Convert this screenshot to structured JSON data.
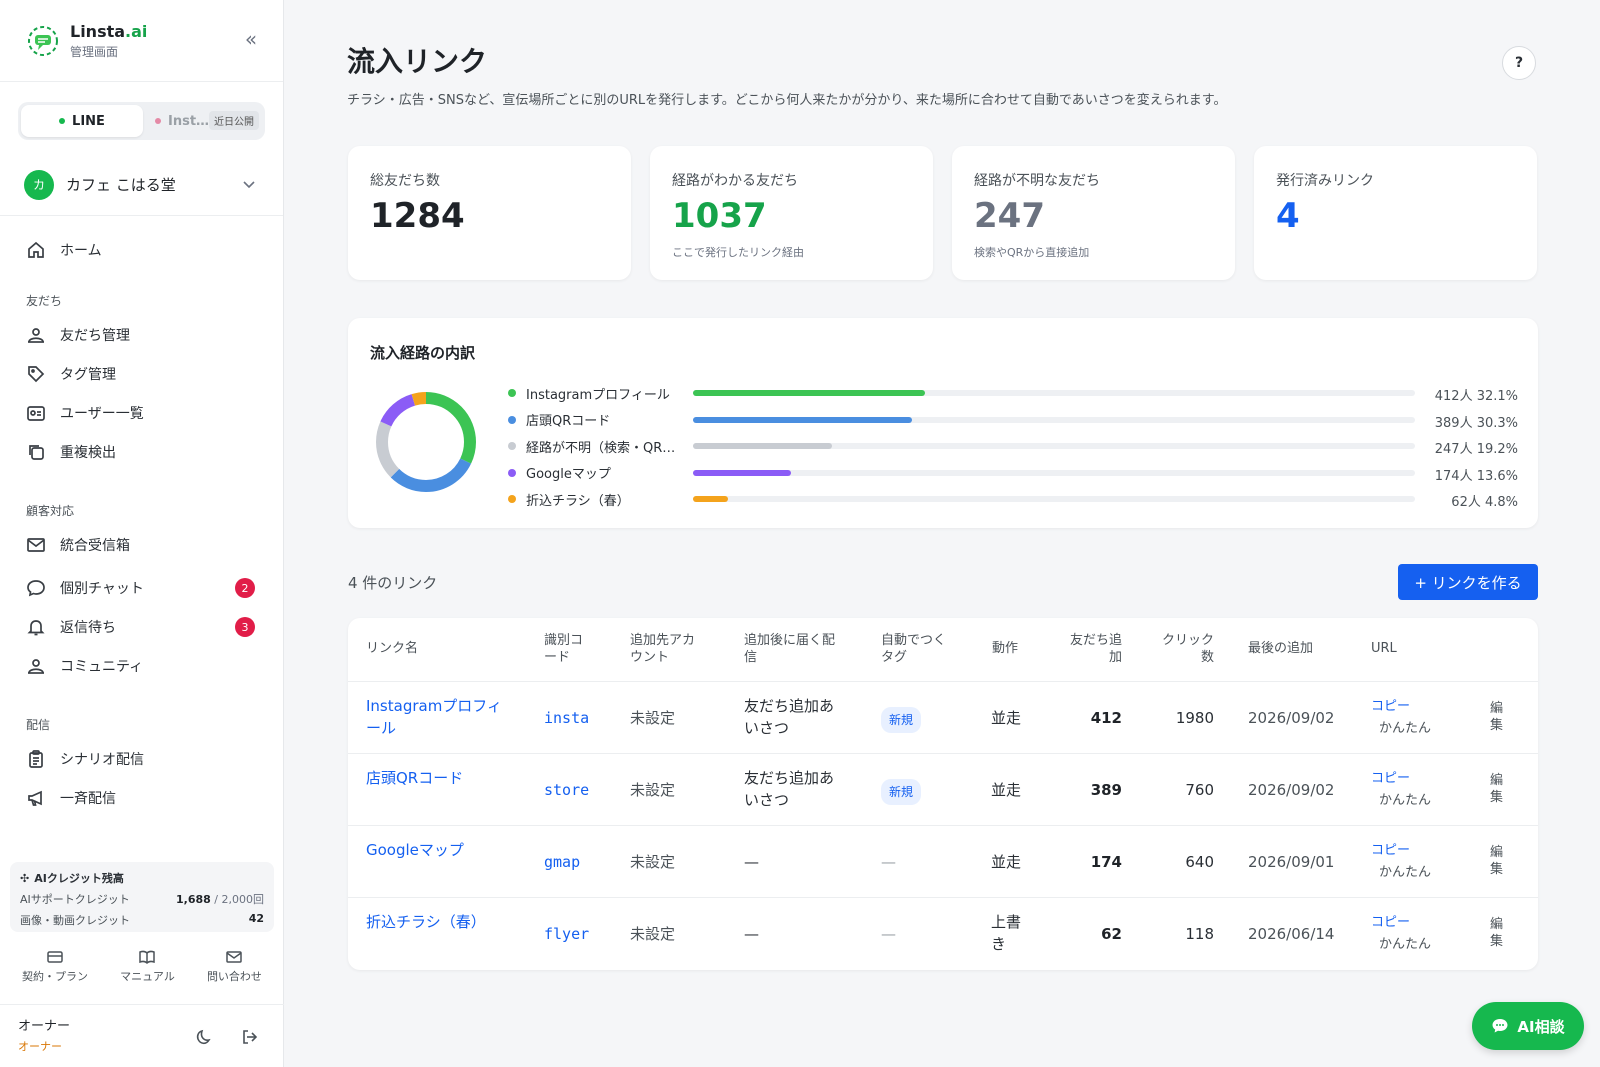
{
  "brand": {
    "name": "Linsta",
    "name_suffix": ".ai",
    "subtitle": "管理画面"
  },
  "channels": {
    "line": "LINE",
    "instagram": "Inst…",
    "soon": "近日公開"
  },
  "account": {
    "avatar": "カ",
    "name": "カフェ こはる堂"
  },
  "nav": {
    "home": "ホーム",
    "section_friends": "友だち",
    "friends_manage": "友だち管理",
    "tags": "タグ管理",
    "users": "ユーザー一覧",
    "duplicates": "重複検出",
    "section_support": "顧客対応",
    "inbox": "統合受信箱",
    "chat": "個別チャット",
    "chat_badge": "2",
    "waiting": "返信待ち",
    "waiting_badge": "3",
    "community": "コミュニティ",
    "section_delivery": "配信",
    "scenario": "シナリオ配信",
    "broadcast": "一斉配信"
  },
  "credit": {
    "title": "AIクレジット残高",
    "support_label": "AIサポートクレジット",
    "support_value": "1,688",
    "support_unit": "/ 2,000回",
    "media_label": "画像・動画クレジット",
    "media_value": "42"
  },
  "footer_links": {
    "plan": "契約・プラン",
    "manual": "マニュアル",
    "contact": "問い合わせ"
  },
  "owner": {
    "name": "オーナー",
    "role": "オーナー"
  },
  "page": {
    "title": "流入リンク",
    "description": "チラシ・広告・SNSなど、宣伝場所ごとに別のURLを発行します。どこから何人来たかが分かり、来た場所に合わせて自動であいさつを変えられます。",
    "help": "?"
  },
  "stats": [
    {
      "label": "総友だち数",
      "value": "1284",
      "note": "",
      "color": "#1f2328"
    },
    {
      "label": "経路がわかる友だち",
      "value": "1037",
      "note": "ここで発行したリンク経由",
      "color": "#16a34a"
    },
    {
      "label": "経路が不明な友だち",
      "value": "247",
      "note": "検索やQRから直接追加",
      "color": "#6b7280"
    },
    {
      "label": "発行済みリンク",
      "value": "4",
      "note": "",
      "color": "#1560f0"
    }
  ],
  "chart_data": {
    "type": "pie",
    "title": "流入経路の内訳",
    "categories": [
      "Instagramプロフィール",
      "店頭QRコード",
      "経路が不明（検索・QR…",
      "Googleマップ",
      "折込チラシ（春）"
    ],
    "values": [
      412,
      389,
      247,
      174,
      62
    ],
    "percents": [
      32.1,
      30.3,
      19.2,
      13.6,
      4.8
    ],
    "labels": [
      "412人 32.1%",
      "389人 30.3%",
      "247人 19.2%",
      "174人 13.6%",
      "62人 4.8%"
    ],
    "colors": [
      "#3cc454",
      "#4a8ee0",
      "#c8ccd2",
      "#8b5cf6",
      "#f4a31c"
    ]
  },
  "links_section": {
    "count_label": "4 件のリンク",
    "create_button": "+ リンクを作る"
  },
  "table": {
    "headers": {
      "name": "リンク名",
      "code": "識別コード",
      "account": "追加先アカウント",
      "delivery": "追加後に届く配信",
      "tag": "自動でつくタグ",
      "action": "動作",
      "friends": "友だち追加",
      "clicks": "クリック数",
      "last": "最後の追加",
      "url": "URL"
    },
    "rows": [
      {
        "name": "Instagramプロフィール",
        "code": "insta",
        "account": "未設定",
        "delivery": "友だち追加あいさつ",
        "tag": "新規",
        "action": "並走",
        "friends": "412",
        "clicks": "1980",
        "last": "2026/09/02",
        "copy": "コピー",
        "easy": "かんたん",
        "edit": "編集"
      },
      {
        "name": "店頭QRコード",
        "code": "store",
        "account": "未設定",
        "delivery": "友だち追加あいさつ",
        "tag": "新規",
        "action": "並走",
        "friends": "389",
        "clicks": "760",
        "last": "2026/09/02",
        "copy": "コピー",
        "easy": "かんたん",
        "edit": "編集"
      },
      {
        "name": "Googleマップ",
        "code": "gmap",
        "account": "未設定",
        "delivery": "—",
        "tag": "—",
        "action": "並走",
        "friends": "174",
        "clicks": "640",
        "last": "2026/09/01",
        "copy": "コピー",
        "easy": "かんたん",
        "edit": "編集"
      },
      {
        "name": "折込チラシ（春）",
        "code": "flyer",
        "account": "未設定",
        "delivery": "—",
        "tag": "—",
        "action": "上書き",
        "friends": "62",
        "clicks": "118",
        "last": "2026/06/14",
        "copy": "コピー",
        "easy": "かんたん",
        "edit": "編集"
      }
    ]
  },
  "ai_button": "AI相談"
}
